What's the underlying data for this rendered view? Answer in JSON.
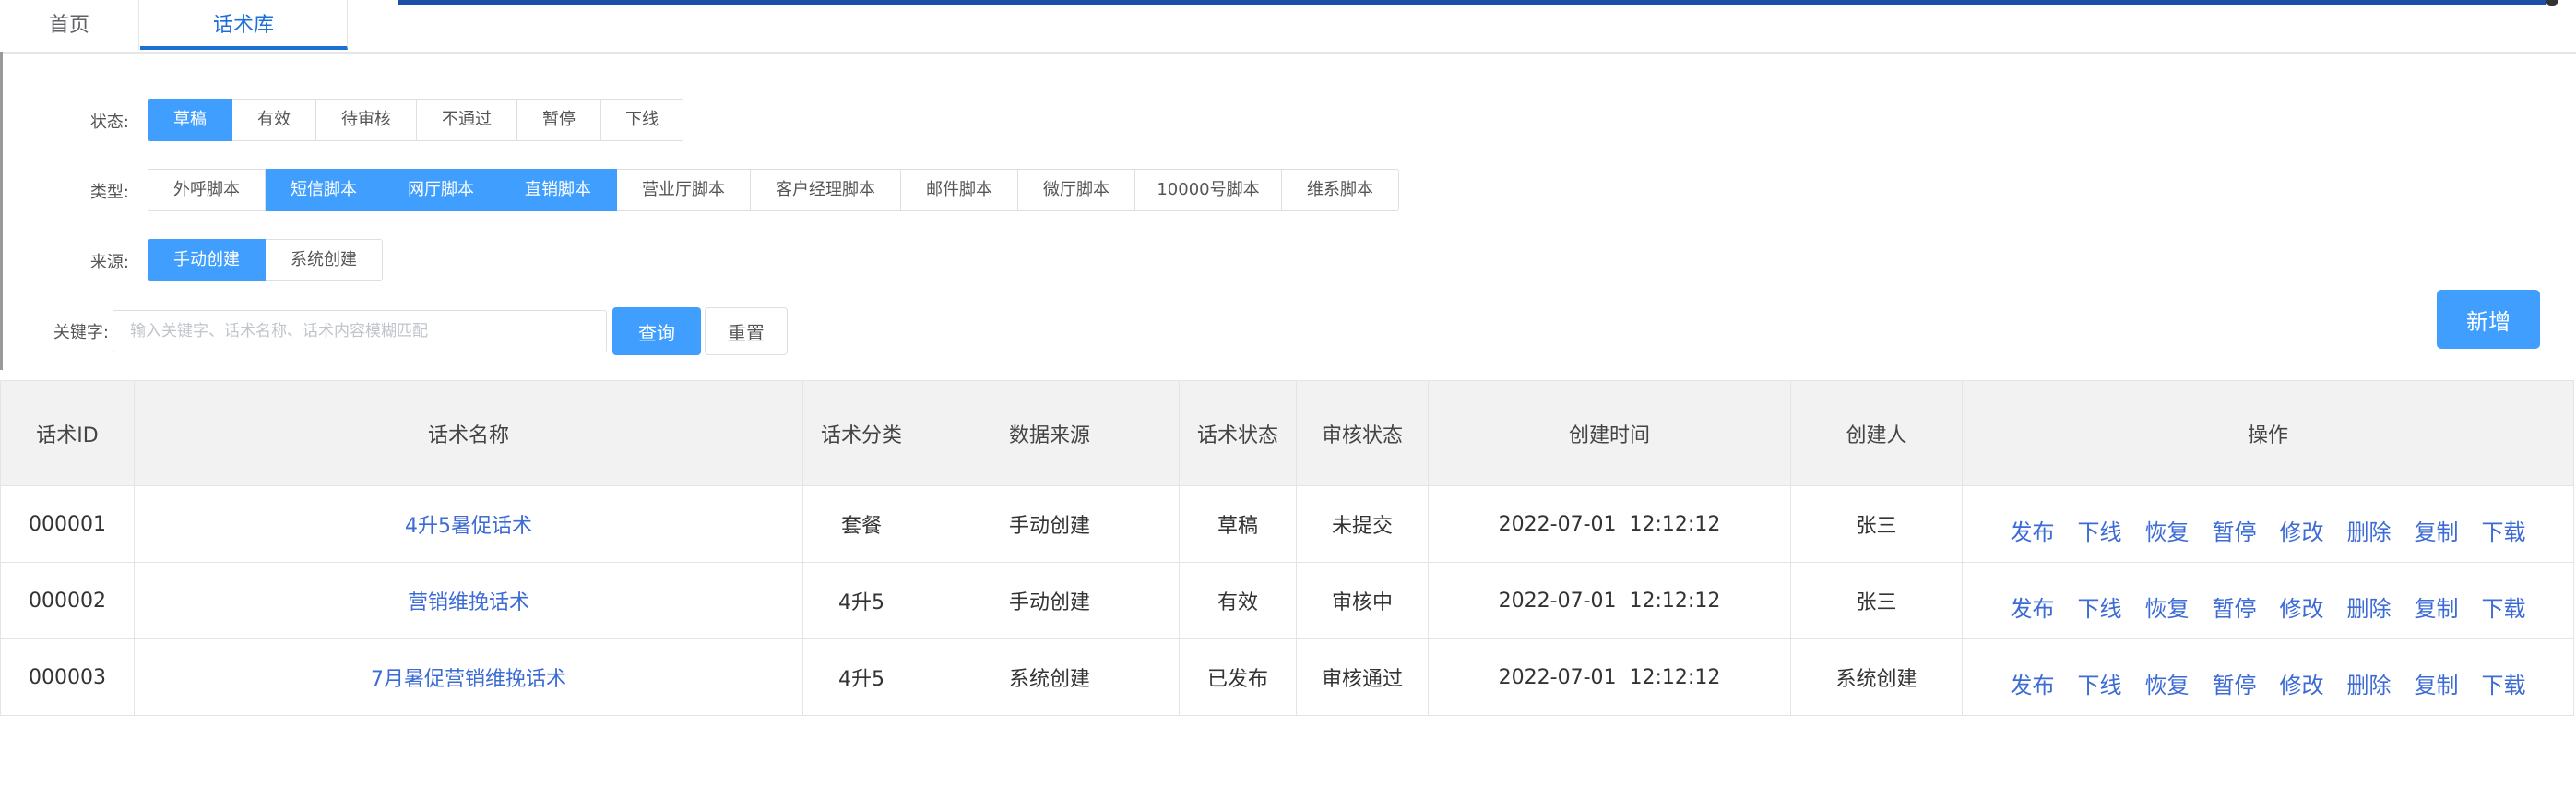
{
  "tabs": [
    {
      "label": "首页"
    },
    {
      "label": "话术库"
    }
  ],
  "filters": {
    "status": {
      "label": "状态:",
      "options": [
        "草稿",
        "有效",
        "待审核",
        "不通过",
        "暂停",
        "下线"
      ],
      "selected": [
        "草稿"
      ]
    },
    "type": {
      "label": "类型:",
      "options": [
        "外呼脚本",
        "短信脚本",
        "网厅脚本",
        "直销脚本",
        "营业厅脚本",
        "客户经理脚本",
        "邮件脚本",
        "微厅脚本",
        "10000号脚本",
        "维系脚本"
      ],
      "selected": [
        "短信脚本",
        "网厅脚本",
        "直销脚本"
      ]
    },
    "source": {
      "label": "来源:",
      "options": [
        "手动创建",
        "系统创建"
      ],
      "selected": [
        "手动创建"
      ]
    },
    "keyword": {
      "label": "关键字:",
      "value": "",
      "placeholder": "输入关键字、话术名称、话术内容模糊匹配"
    },
    "query_label": "查询",
    "reset_label": "重置"
  },
  "add_label": "新增",
  "table": {
    "columns": [
      "话术ID",
      "话术名称",
      "话术分类",
      "数据来源",
      "话术状态",
      "审核状态",
      "创建时间",
      "创建人",
      "操作"
    ],
    "actions": [
      "发布",
      "下线",
      "恢复",
      "暂停",
      "修改",
      "删除",
      "复制",
      "下载"
    ],
    "rows": [
      {
        "id": "000001",
        "name": "4升5暑促话术",
        "category": "套餐",
        "source": "手动创建",
        "status": "草稿",
        "review": "未提交",
        "created": "2022-07-01  12:12:12",
        "creator": "张三"
      },
      {
        "id": "000002",
        "name": "营销维挽话术",
        "category": "4升5",
        "source": "手动创建",
        "status": "有效",
        "review": "审核中",
        "created": "2022-07-01  12:12:12",
        "creator": "张三"
      },
      {
        "id": "000003",
        "name": "7月暑促营销维挽话术",
        "category": "4升5",
        "source": "系统创建",
        "status": "已发布",
        "review": "审核通过",
        "created": "2022-07-01  12:12:12",
        "creator": "系统创建"
      }
    ]
  },
  "colors": {
    "primary": "#409eff",
    "link": "#3c6bd6",
    "active_tab": "#1d6fd8"
  }
}
